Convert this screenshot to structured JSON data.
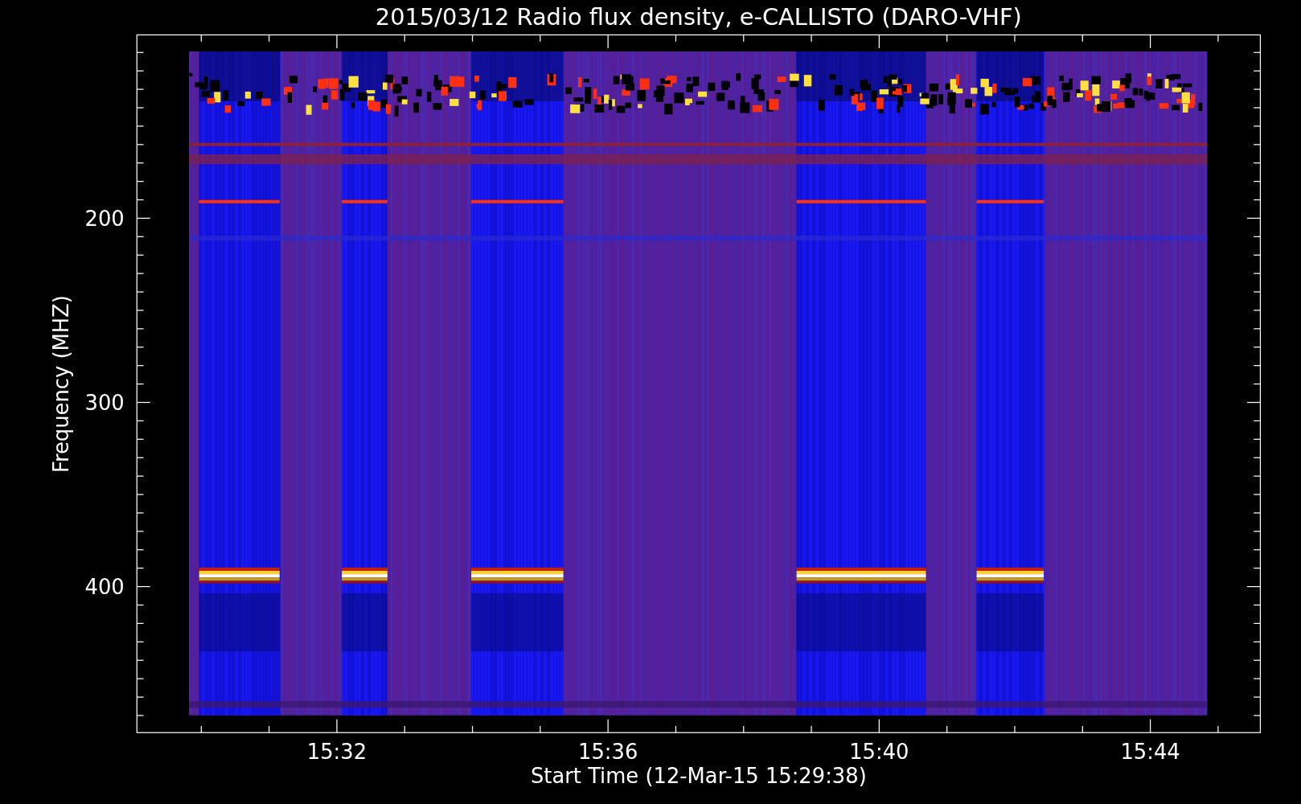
{
  "plot": {
    "title": "2015/03/12  Radio flux density, e-CALLISTO (DARO-VHF)",
    "xlabel": "Start Time (12-Mar-15 15:29:38)",
    "ylabel": "Frequency (MHZ)",
    "x_tick_labels": [
      {
        "label": "15:32"
      },
      {
        "label": "15:36"
      },
      {
        "label": "15:40"
      },
      {
        "label": "15:44"
      }
    ],
    "y_tick_labels": [
      {
        "label": "200"
      },
      {
        "label": "300"
      },
      {
        "label": "400"
      }
    ]
  }
}
